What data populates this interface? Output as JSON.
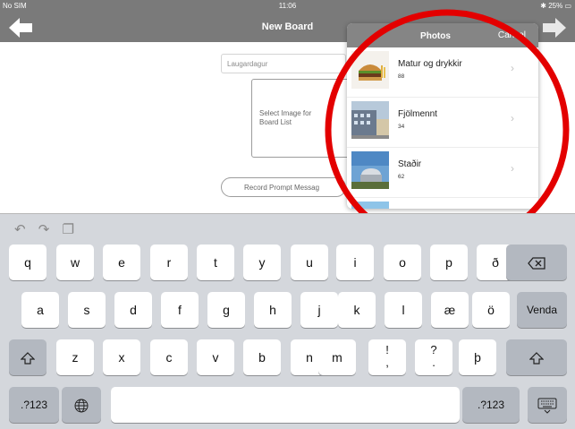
{
  "status_bar": {
    "carrier": "No SIM",
    "time": "11:06",
    "battery": "25%"
  },
  "nav": {
    "title": "New Board"
  },
  "form": {
    "name_value": "Laugardagur",
    "image_label_line1": "Select Image for",
    "image_label_line2": "Board List",
    "record_label": "Record Prompt Messag"
  },
  "photos_popover": {
    "title": "Photos",
    "cancel": "Cancel",
    "albums": [
      {
        "name": "Matur og drykkir",
        "count": "88"
      },
      {
        "name": "Fjölmennt",
        "count": "34"
      },
      {
        "name": "Staðir",
        "count": "62"
      }
    ]
  },
  "keyboard": {
    "toolbar_icons": [
      "undo-icon",
      "redo-icon",
      "paste-icon"
    ],
    "row1": [
      "q",
      "w",
      "e",
      "r",
      "t",
      "y",
      "u",
      "i",
      "o",
      "p",
      "ð"
    ],
    "row2": [
      "a",
      "s",
      "d",
      "f",
      "g",
      "h",
      "j",
      "k",
      "l",
      "æ",
      "ö"
    ],
    "row3": [
      "z",
      "x",
      "c",
      "v",
      "b",
      "n",
      "m",
      "!",
      ",",
      "?",
      ".",
      "þ"
    ],
    "return_label": "Venda",
    "numbers_label": ".?123"
  },
  "colors": {
    "nav_gray": "#7a7a7a",
    "highlight_circle": "#e30000",
    "keyboard_bg": "#d4d7dc"
  }
}
